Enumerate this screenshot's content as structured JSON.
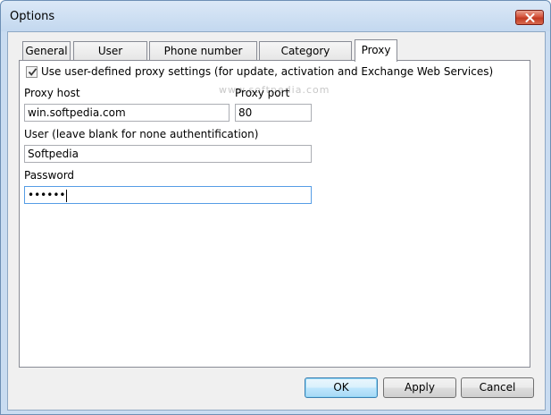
{
  "window": {
    "title": "Options"
  },
  "tabs": [
    {
      "label": "General"
    },
    {
      "label": "User interface"
    },
    {
      "label": "Phone number format"
    },
    {
      "label": "Category manager"
    },
    {
      "label": "Proxy"
    }
  ],
  "active_tab": "Proxy",
  "proxy": {
    "use_proxy_label": "Use user-defined proxy settings (for update, activation and Exchange Web Services)",
    "use_proxy_checked": true,
    "host_label": "Proxy host",
    "host_value": "win.softpedia.com",
    "port_label": "Proxy port",
    "port_value": "80",
    "user_label": "User (leave blank for none authentification)",
    "user_value": "Softpedia",
    "password_label": "Password",
    "password_value": "••••••"
  },
  "watermark": "www.softpedia.com",
  "buttons": {
    "ok": "OK",
    "apply": "Apply",
    "cancel": "Cancel"
  },
  "icons": {
    "close": "close-icon",
    "check": "checkmark-icon"
  }
}
